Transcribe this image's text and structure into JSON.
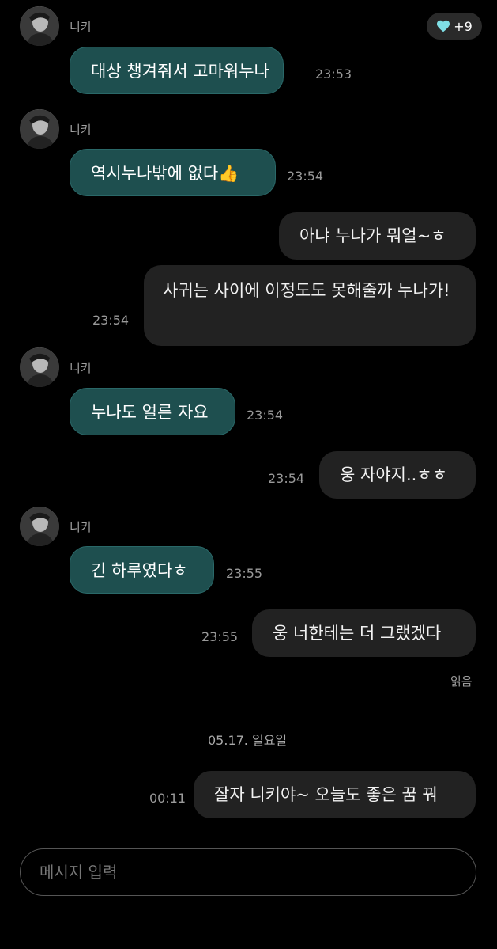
{
  "reaction": {
    "icon": "heart-icon",
    "count": "+9",
    "color": "#7fdfe6"
  },
  "messages": [
    {
      "sender": "니키",
      "text": "대상 챙겨줘서 고마워누나",
      "time": "23:53"
    },
    {
      "sender": "니키",
      "text": "역시누나밖에 없다👍",
      "time": "23:54"
    },
    {
      "text": "아냐 누나가 뭐얼~ㅎ"
    },
    {
      "text": "사귀는 사이에 이정도도 못해줄까 누나가!",
      "time": "23:54"
    },
    {
      "sender": "니키",
      "text": "누나도 얼른 자요",
      "time": "23:54"
    },
    {
      "text": "웅 자야지..ㅎㅎ",
      "time": "23:54"
    },
    {
      "sender": "니키",
      "text": "긴 하루였다ㅎ",
      "time": "23:55"
    },
    {
      "text": "웅 너한테는 더 그랬겠다",
      "time": "23:55"
    },
    {
      "text": "잘자 니키야~ 오늘도 좋은 꿈 꿔",
      "time": "00:11"
    }
  ],
  "read_receipt": "읽음",
  "date_divider": "05.17. 일요일",
  "composer": {
    "placeholder": "메시지 입력"
  },
  "colors": {
    "background": "#000000",
    "received_bubble": "#1e4f4f",
    "sent_bubble": "#222222"
  }
}
